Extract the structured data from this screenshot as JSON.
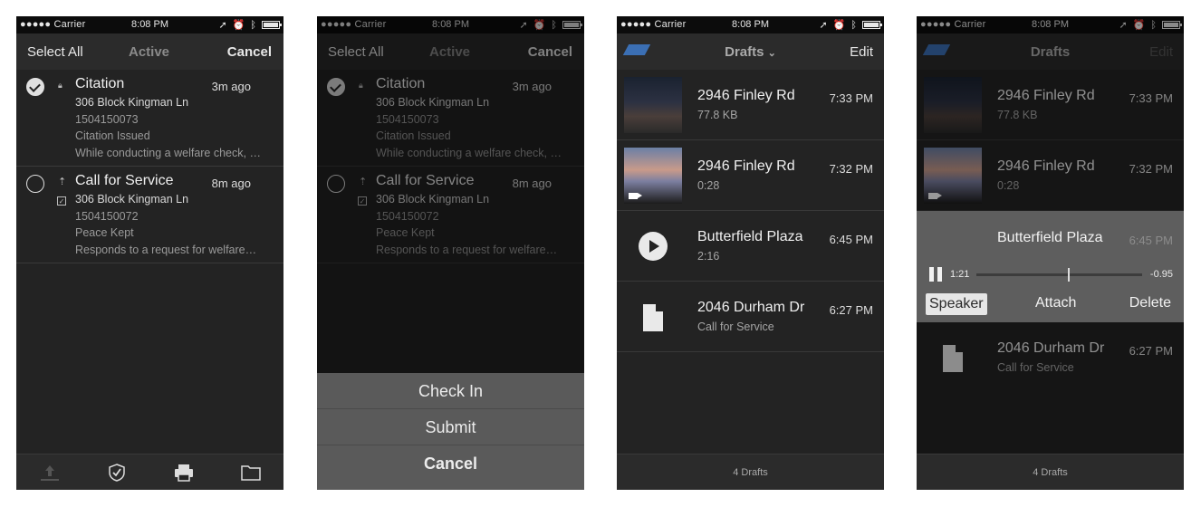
{
  "status": {
    "carrier": "●●●●● Carrier",
    "time": "8:08 PM"
  },
  "screen1": {
    "nav": {
      "left": "Select All",
      "center": "Active",
      "right": "Cancel"
    },
    "items": [
      {
        "title": "Citation",
        "time": "3m ago",
        "address": "306 Block Kingman Ln",
        "number": "1504150073",
        "status": "Citation Issued",
        "desc": "While conducting a welfare check, …"
      },
      {
        "title": "Call for Service",
        "time": "8m ago",
        "address": "306 Block Kingman Ln",
        "number": "1504150072",
        "status": "Peace Kept",
        "desc": "Responds to a request for welfare…"
      }
    ]
  },
  "screen2": {
    "nav": {
      "left": "Select All",
      "center": "Active",
      "right": "Cancel"
    },
    "items": [
      {
        "title": "Citation",
        "time": "3m ago",
        "address": "306 Block Kingman Ln",
        "number": "1504150073",
        "status": "Citation Issued",
        "desc": "While conducting a welfare check, …"
      },
      {
        "title": "Call for Service",
        "time": "8m ago",
        "address": "306 Block Kingman Ln",
        "number": "1504150072",
        "status": "Peace Kept",
        "desc": "Responds to a request for welfare…"
      }
    ],
    "sheet": {
      "check_in": "Check In",
      "submit": "Submit",
      "cancel": "Cancel"
    }
  },
  "screen3": {
    "nav": {
      "title": "Drafts",
      "right": "Edit"
    },
    "drafts": [
      {
        "title": "2946 Finley Rd",
        "sub": "77.8 KB",
        "time": "7:33 PM"
      },
      {
        "title": "2946 Finley Rd",
        "sub": "0:28",
        "time": "7:32 PM"
      },
      {
        "title": "Butterfield Plaza",
        "sub": "2:16",
        "time": "6:45 PM"
      },
      {
        "title": "2046 Durham Dr",
        "sub": "Call for Service",
        "time": "6:27 PM"
      }
    ],
    "footer": "4 Drafts"
  },
  "screen4": {
    "nav": {
      "title": "Drafts",
      "right": "Edit"
    },
    "drafts": [
      {
        "title": "2946 Finley Rd",
        "sub": "77.8 KB",
        "time": "7:33 PM"
      },
      {
        "title": "2946 Finley Rd",
        "sub": "0:28",
        "time": "7:32 PM"
      },
      {
        "title": "2046 Durham Dr",
        "sub": "Call for Service",
        "time": "6:27 PM"
      }
    ],
    "player": {
      "title": "Butterfield Plaza",
      "time": "6:45 PM",
      "elapsed": "1:21",
      "remaining": "-0.95",
      "progress": 0.55,
      "speaker": "Speaker",
      "attach": "Attach",
      "delete": "Delete"
    },
    "footer": "4 Drafts"
  }
}
